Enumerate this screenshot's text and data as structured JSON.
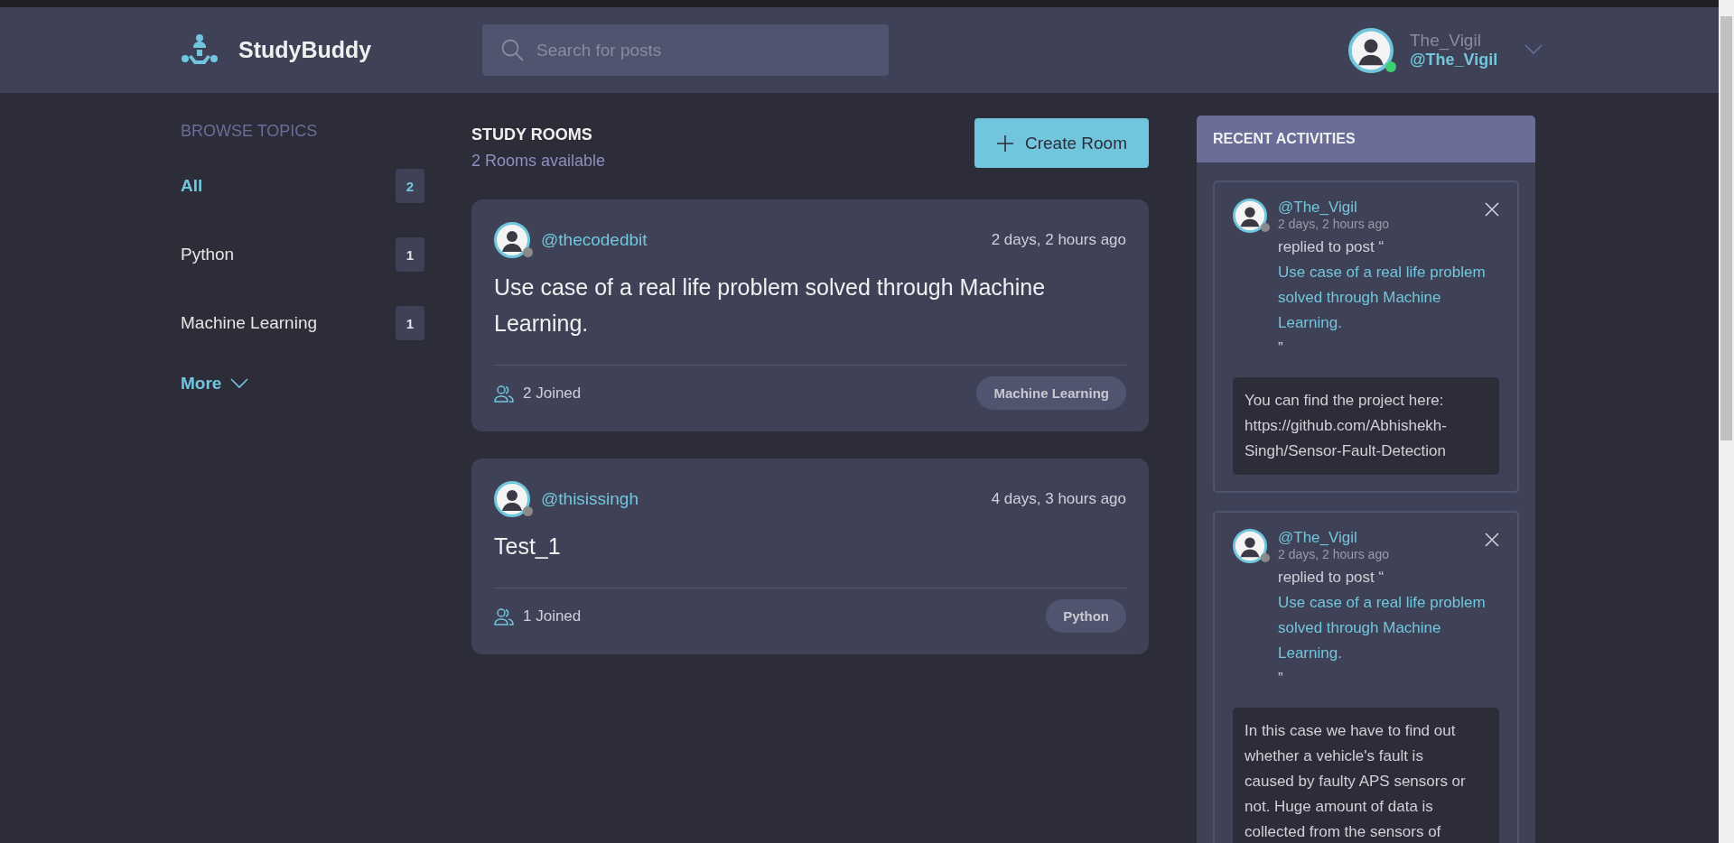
{
  "header": {
    "logo": "StudyBuddy",
    "search": {
      "placeholder": "Search for posts"
    },
    "user": {
      "name": "The_Vigil",
      "handle": "@The_Vigil",
      "online": true
    }
  },
  "topics": {
    "title": "BROWSE TOPICS",
    "items": [
      {
        "name": "All",
        "count": "2",
        "selected": true
      },
      {
        "name": "Python",
        "count": "1",
        "selected": false
      },
      {
        "name": "Machine Learning",
        "count": "1",
        "selected": false
      }
    ],
    "more": "More"
  },
  "rooms": {
    "title": "STUDY ROOMS",
    "subtitle": "2 Rooms available",
    "create_button": "Create Room",
    "items": [
      {
        "host": "@thecodedbit",
        "online": false,
        "time": "2 days, 2 hours ago",
        "title": "Use case of a real life problem solved through Machine Learning.",
        "joined": "2 Joined",
        "topic": "Machine Learning"
      },
      {
        "host": "@thisissingh",
        "online": false,
        "time": "4 days, 3 hours ago",
        "title": "Test_1",
        "joined": "1 Joined",
        "topic": "Python"
      }
    ]
  },
  "activities": {
    "title": "RECENT ACTIVITIES",
    "items": [
      {
        "user": "@The_Vigil",
        "online": false,
        "time": "2 days, 2 hours ago",
        "action": "replied to post “",
        "post": "Use case of a real life problem solved through Machine Learning.",
        "closing": "”",
        "body": "You can find the project here: https://github.com/Abhishekh-Singh/Sensor-Fault-Detection"
      },
      {
        "user": "@The_Vigil",
        "online": false,
        "time": "2 days, 2 hours ago",
        "action": "replied to post “",
        "post": "Use case of a real life problem solved through Machine Learning.",
        "closing": "”",
        "body": "In this case we have to find out whether a vehicle's fault is caused by faulty APS sensors or not. Huge amount of data is collected from the sensors of"
      }
    ]
  }
}
